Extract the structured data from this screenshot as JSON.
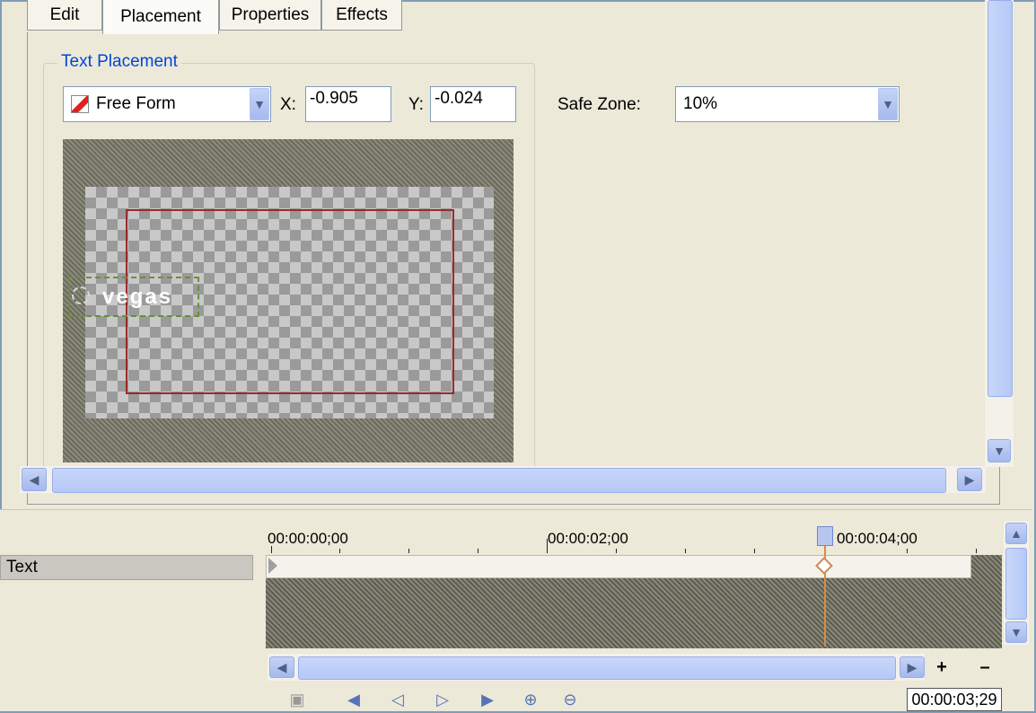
{
  "tabs": [
    {
      "label": "Edit",
      "active": false
    },
    {
      "label": "Placement",
      "active": true
    },
    {
      "label": "Properties",
      "active": false
    },
    {
      "label": "Effects",
      "active": false
    }
  ],
  "placement": {
    "group_title": "Text Placement",
    "mode": "Free Form",
    "x_label": "X:",
    "x_value": "-0.905",
    "y_label": "Y:",
    "y_value": "-0.024",
    "safe_zone_label": "Safe Zone:",
    "safe_zone_value": "10%"
  },
  "preview": {
    "text": "vegas"
  },
  "timeline": {
    "track_label": "Text",
    "ruler_labels": [
      "00:00:00;00",
      "00:00:02;00",
      "00:00:04;00"
    ],
    "timecode": "00:00:03;29"
  },
  "colors": {
    "accent": "#0046d5",
    "safe_zone_border": "#9b2a2a",
    "cursor": "#d98b45"
  }
}
